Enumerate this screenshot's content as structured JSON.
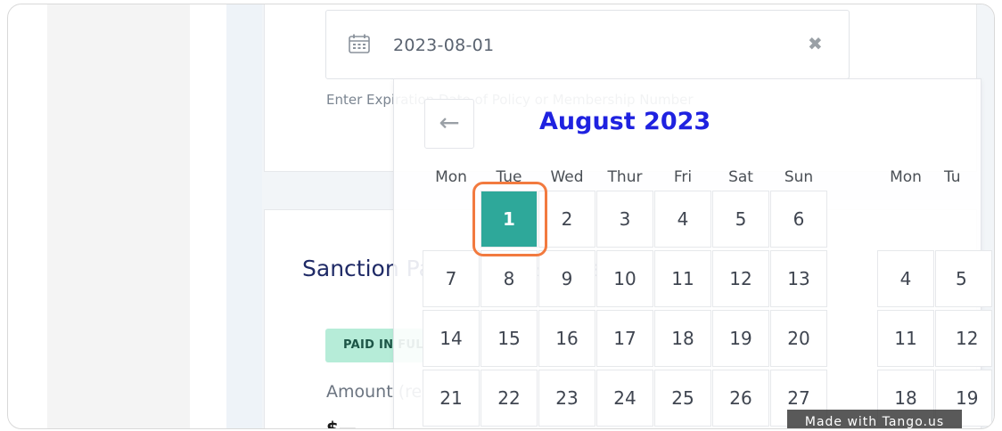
{
  "date_field": {
    "value": "2023-08-01",
    "icon": "calendar-icon",
    "clear_icon": "close-icon",
    "clear_glyph": "✖"
  },
  "helper_text": "Enter Expiration Date of Policy or Membership Number",
  "section": {
    "title": "Sanction Payments & Dues",
    "badge": "PAID IN FULL",
    "amount_label": "Amount (remaining)",
    "amount_value": "$—"
  },
  "calendar": {
    "prev_glyph": "←",
    "month_title": "August 2023",
    "weekdays": [
      "Mon",
      "Tue",
      "Wed",
      "Thur",
      "Fri",
      "Sat",
      "Sun"
    ],
    "next_weekdays": [
      "Mon",
      "Tu"
    ],
    "weeks": [
      [
        "",
        "1",
        "2",
        "3",
        "4",
        "5",
        "6"
      ],
      [
        "7",
        "8",
        "9",
        "10",
        "11",
        "12",
        "13"
      ],
      [
        "14",
        "15",
        "16",
        "17",
        "18",
        "19",
        "20"
      ],
      [
        "21",
        "22",
        "23",
        "24",
        "25",
        "26",
        "27"
      ]
    ],
    "next_month_partial": [
      [
        "",
        ""
      ],
      [
        "4",
        "5"
      ],
      [
        "11",
        "12"
      ],
      [
        "18",
        "19"
      ]
    ],
    "selected_day": "1",
    "accent": "#2ea89a",
    "title_color": "#1f22e0"
  },
  "watermark": "Made with Tango.us"
}
